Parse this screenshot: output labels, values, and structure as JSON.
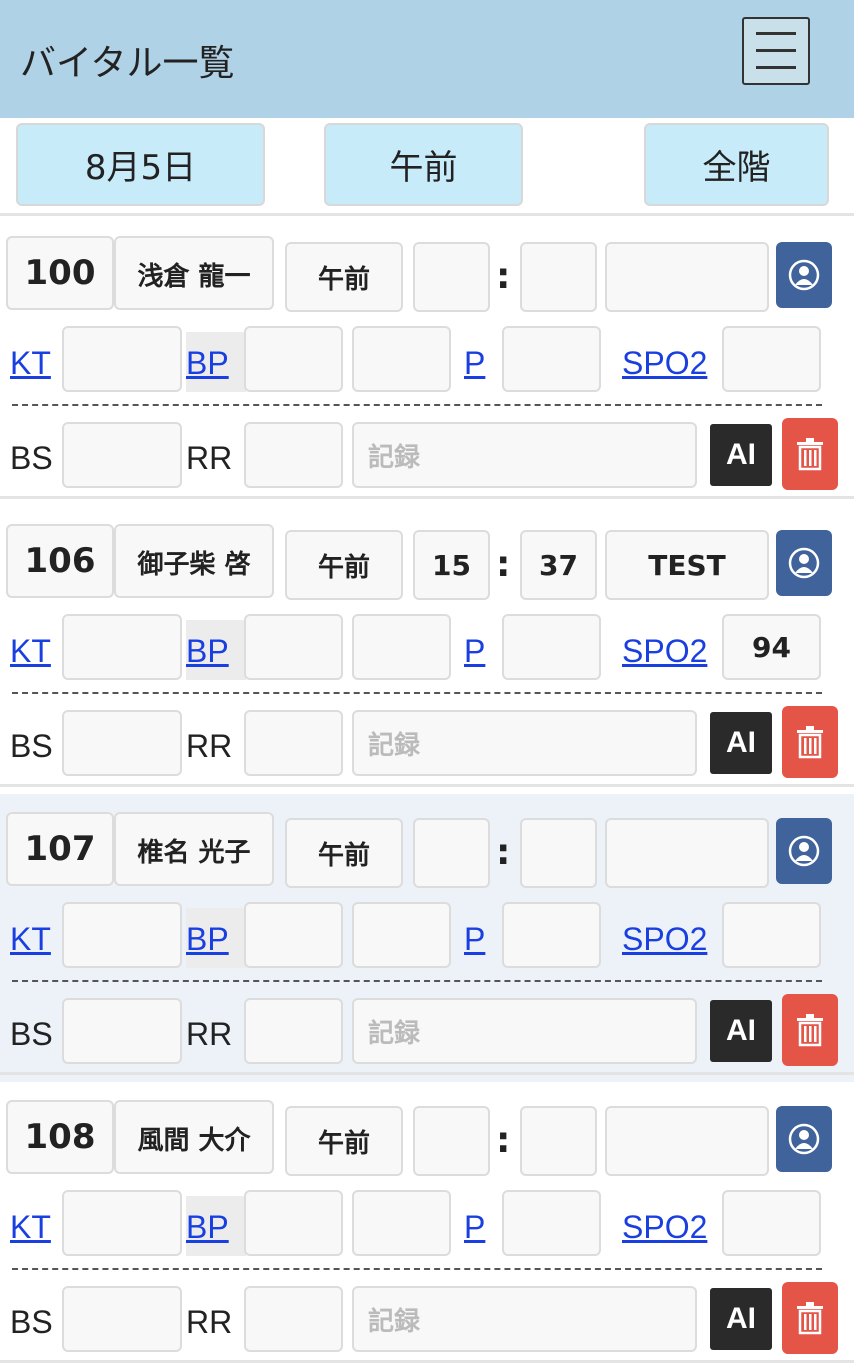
{
  "header": {
    "title": "バイタル一覧",
    "menu_icon": "hamburger-menu-icon",
    "bg_color": "#b0d2e6"
  },
  "filters": {
    "date": "8月5日",
    "period": "午前",
    "floor": "全階"
  },
  "labels": {
    "kt": "KT",
    "bp": "BP",
    "p": "P",
    "spo2": "SPO2",
    "bs": "BS",
    "rr": "RR",
    "record_placeholder": "記録",
    "ai": "AI",
    "colon": ":"
  },
  "colors": {
    "link": "#1a3fe0",
    "user_button": "#41639c",
    "delete_button": "#e45447",
    "ai_button": "#2a2a2a",
    "filter_bg": "#c8ebfa",
    "highlight_row": "#edf2f9"
  },
  "patients": [
    {
      "room": "100",
      "name": "浅倉 龍一",
      "ampm": "午前",
      "hour": "",
      "minute": "",
      "note": "",
      "kt": "",
      "bp_high": "",
      "bp_low": "",
      "p": "",
      "spo2": "",
      "bs": "",
      "rr": "",
      "record": ""
    },
    {
      "room": "106",
      "name": "御子柴 啓",
      "ampm": "午前",
      "hour": "15",
      "minute": "37",
      "note": "TEST",
      "kt": "",
      "bp_high": "",
      "bp_low": "",
      "p": "",
      "spo2": "94",
      "bs": "",
      "rr": "",
      "record": ""
    },
    {
      "room": "107",
      "name": "椎名 光子",
      "ampm": "午前",
      "hour": "",
      "minute": "",
      "note": "",
      "kt": "",
      "bp_high": "",
      "bp_low": "",
      "p": "",
      "spo2": "",
      "bs": "",
      "rr": "",
      "record": ""
    },
    {
      "room": "108",
      "name": "風間 大介",
      "ampm": "午前",
      "hour": "",
      "minute": "",
      "note": "",
      "kt": "",
      "bp_high": "",
      "bp_low": "",
      "p": "",
      "spo2": "",
      "bs": "",
      "rr": "",
      "record": ""
    }
  ]
}
